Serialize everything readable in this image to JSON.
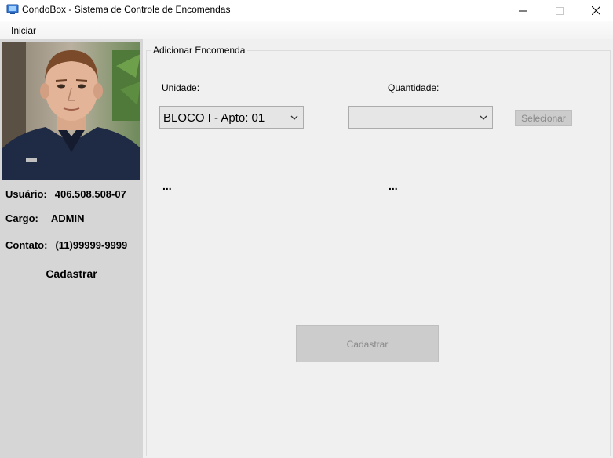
{
  "window": {
    "title": "CondoBox - Sistema de Controle de Encomendas"
  },
  "menu": {
    "items": [
      "Iniciar"
    ]
  },
  "sidebar": {
    "usuario_label": "Usuário:",
    "usuario_value": "406.508.508-07",
    "cargo_label": "Cargo:",
    "cargo_value": "ADMIN",
    "contato_label": "Contato:",
    "contato_value": "(11)99999-9999",
    "cadastrar_label": "Cadastrar"
  },
  "form": {
    "group_title": "Adicionar Encomenda",
    "unidade_label": "Unidade:",
    "unidade_value": "BLOCO I - Apto: 01",
    "quantidade_label": "Quantidade:",
    "quantidade_value": "",
    "selecionar_label": "Selecionar",
    "unidade_info": "...",
    "quantidade_info": "...",
    "cadastrar_label": "Cadastrar"
  },
  "colors": {
    "sidebar_bg": "#d6d6d6",
    "window_bg": "#f0f0f0",
    "disabled_button": "#cccccc"
  }
}
